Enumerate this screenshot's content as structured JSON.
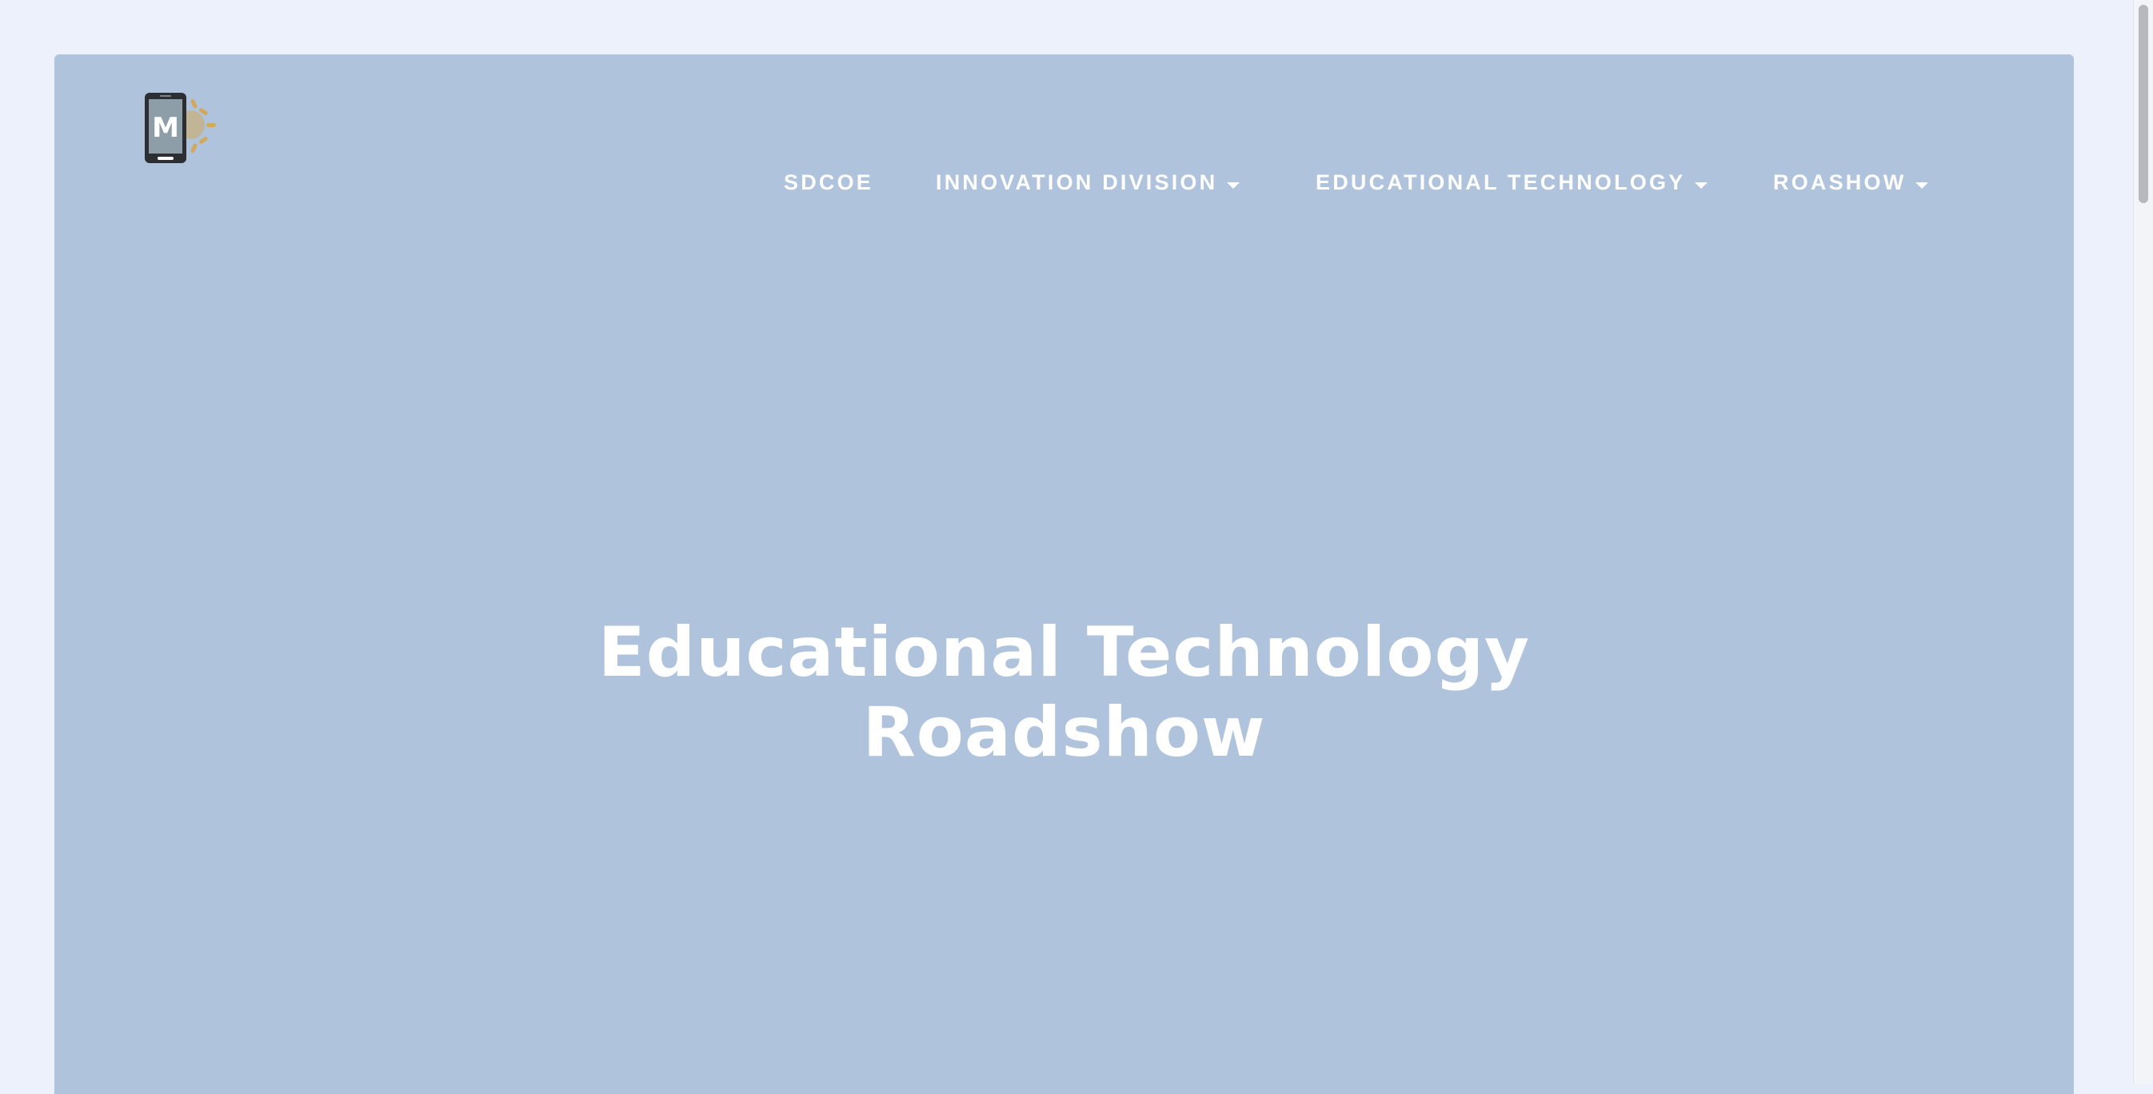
{
  "nav": {
    "items": [
      {
        "label": "SDCOE",
        "has_dropdown": false
      },
      {
        "label": "INNOVATION DIVISION",
        "has_dropdown": true
      },
      {
        "label": "EDUCATIONAL TECHNOLOGY",
        "has_dropdown": true
      },
      {
        "label": "ROASHOW",
        "has_dropdown": true
      }
    ]
  },
  "logo": {
    "letter": "M",
    "icon": "phone-sun-logo-icon"
  },
  "hero": {
    "title_line1": "Educational Technology",
    "title_line2": "Roadshow"
  },
  "colors": {
    "page_background": "#edf1fb",
    "hero_background": "#afc3dc",
    "text": "#ffffff",
    "logo_sun": "#d2a95b",
    "logo_phone": "#2b2f33"
  }
}
